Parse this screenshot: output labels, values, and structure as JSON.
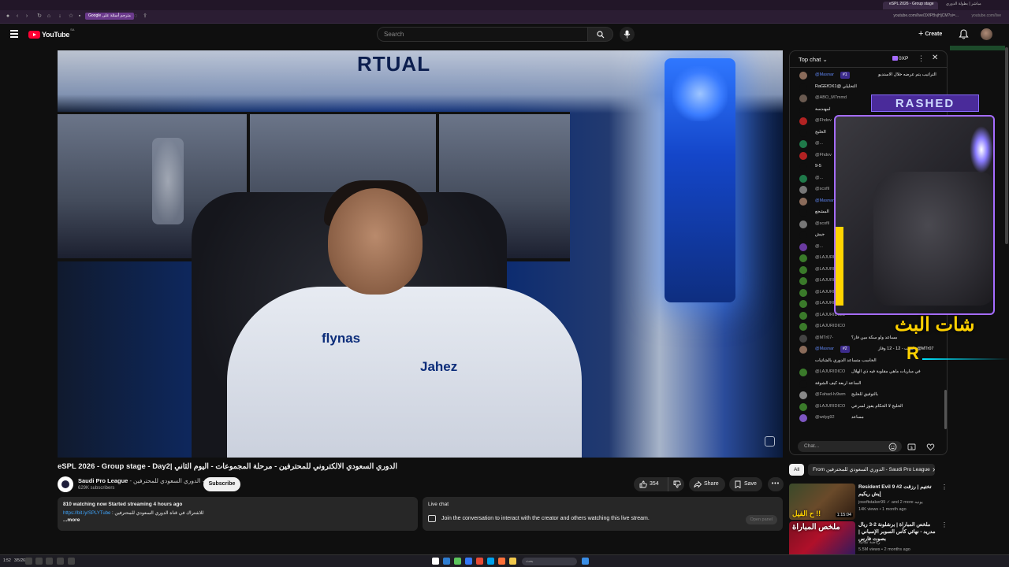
{
  "browser": {
    "tabs": [
      "eSPL 2026 - Group stage",
      "مباشر | بطولة الدوري"
    ],
    "bookmark_pill": "Google مترجم أسئلة على",
    "url": "youtube.com/live/3XfPBvjHjCM?si=...",
    "url_right": "youtube.com/live"
  },
  "header": {
    "logo_text": "YouTube",
    "region": "SA",
    "search_placeholder": "Search",
    "create_label": "Create"
  },
  "video": {
    "shirt_sponsor": "flynas",
    "shirt_brand": "Jahez",
    "banner_text": "RTUAL",
    "title": "eSPL 2026 - Group stage - Day2| الدوري السعودي الالكتروني للمحترفين - مرحلة المجموعات - اليوم الثاني",
    "channel_name": "Saudi Pro League",
    "channel_name_ar": "الدوري السعودي للمحترفين",
    "subscribers": "629K subscribers",
    "subscribe_label": "Subscribe",
    "likes": "354",
    "share_label": "Share",
    "save_label": "Save",
    "more_label": "•••"
  },
  "description": {
    "line1": "810 watching now  Started streaming 4 hours ago",
    "link": "https://bit.ly/SPLYTube",
    "line2_text": ": للاشتراك في قناة الدوري السعودي للمحترفين",
    "more": "...more"
  },
  "live_chat_card": {
    "title": "Live chat",
    "text": "Join the conversation to interact with the creator and others watching this live stream.",
    "open_panel": "Open panel"
  },
  "chat": {
    "header": "Top chat",
    "xp": "0XP",
    "input_placeholder": "Chat...",
    "messages": [
      {
        "name": "@Masnar",
        "badge": "#1",
        "text": "التراتيب يتم عرضه خلال الاستديو",
        "mod": true,
        "color": "#8a6b5a"
      },
      {
        "name": "",
        "badge": "",
        "text": "RaGEfOX1@ التحليلي",
        "mod": false,
        "color": "#0f0f0f"
      },
      {
        "name": "@ABO_M7mmd",
        "badge": "",
        "text": "",
        "mod": false,
        "color": "#6a5a50"
      },
      {
        "name": "",
        "badge": "",
        "text": "لمهندسة",
        "mod": false,
        "color": "#0f0f0f"
      },
      {
        "name": "@Fhdov",
        "badge": "",
        "text": "",
        "mod": false,
        "color": "#b22222"
      },
      {
        "name": "",
        "badge": "",
        "text": "الخليج",
        "mod": false,
        "color": "#0f0f0f"
      },
      {
        "name": "@...",
        "badge": "",
        "text": "5-9",
        "mod": false,
        "color": "#1f7a4a"
      },
      {
        "name": "@Fhdov",
        "badge": "",
        "text": "",
        "mod": false,
        "color": "#b22222"
      },
      {
        "name": "",
        "badge": "",
        "text": "9-5",
        "mod": false,
        "color": "#0f0f0f"
      },
      {
        "name": "@...",
        "badge": "",
        "text": "5-9",
        "mod": false,
        "color": "#1f7a4a"
      },
      {
        "name": "@scofil",
        "badge": "",
        "text": "",
        "mod": false,
        "color": "#777"
      },
      {
        "name": "@Masnar",
        "badge": "",
        "text": "",
        "mod": true,
        "color": "#8a6b5a"
      },
      {
        "name": "",
        "badge": "",
        "text": "المشجع",
        "mod": false,
        "color": "#0f0f0f"
      },
      {
        "name": "@scofil",
        "badge": "",
        "text": "",
        "mod": false,
        "color": "#777"
      },
      {
        "name": "",
        "badge": "",
        "text": "جيش",
        "mod": false,
        "color": "#0f0f0f"
      },
      {
        "name": "@...",
        "badge": "",
        "text": "9-5",
        "mod": false,
        "color": "#6a3aa0"
      },
      {
        "name": "@LAJURIDICO",
        "badge": "",
        "text": "",
        "mod": false,
        "color": "#3a7a2a"
      },
      {
        "name": "@LAJURIDICO",
        "badge": "",
        "text": "",
        "mod": false,
        "color": "#3a7a2a"
      },
      {
        "name": "@LAJURIDICO",
        "badge": "",
        "text": "",
        "mod": false,
        "color": "#3a7a2a"
      },
      {
        "name": "@LAJURIDICO",
        "badge": "",
        "text": "",
        "mod": false,
        "color": "#3a7a2a"
      },
      {
        "name": "@LAJURIDICO",
        "badge": "",
        "text": "",
        "mod": false,
        "color": "#3a7a2a"
      },
      {
        "name": "@LAJURIDICO",
        "badge": "",
        "text": "",
        "mod": false,
        "color": "#3a7a2a"
      },
      {
        "name": "@LAJURIDICO",
        "badge": "",
        "text": "",
        "mod": false,
        "color": "#3a7a2a"
      },
      {
        "name": "@MTr07-",
        "badge": "",
        "text": "مساعد ولو سكة مين فاز؟",
        "mod": false,
        "color": "#444"
      },
      {
        "name": "@Masnar",
        "badge": "#2",
        "text": "انتهت - 12 - 12 وفاز -@MTr07",
        "mod": true,
        "color": "#8a6b5a"
      },
      {
        "name": "",
        "badge": "",
        "text": "الخاسب متساعد الدوري بالشاتيات",
        "mod": false,
        "color": "#0f0f0f"
      },
      {
        "name": "@LAJURIDICO",
        "badge": "",
        "text": "في مباريات ماهي مقلوبة فيه ذي الهلال",
        "mod": false,
        "color": "#3a7a2a"
      },
      {
        "name": "",
        "badge": "",
        "text": "الساعة اربعة كيف الشوفة",
        "mod": false,
        "color": "#0f0f0f"
      },
      {
        "name": "@Fahad-lv9wm",
        "badge": "",
        "text": "بالتوفيق للخليج",
        "mod": false,
        "color": "#888"
      },
      {
        "name": "@LAJURIDICO",
        "badge": "",
        "text": "الخليج لا الحكام يفوز لسرعي",
        "mod": false,
        "color": "#3a7a2a"
      },
      {
        "name": "@wdyg92",
        "badge": "",
        "text": "مساعد",
        "mod": false,
        "color": "#7e57c2"
      }
    ]
  },
  "overlay": {
    "name": "RASHED",
    "chat_label": "شات البث",
    "logo_letter": "R"
  },
  "filters": {
    "all": "All",
    "from": "From الدوري السعودي للمحترفين - Saudi Pro League"
  },
  "recommendations": [
    {
      "title": "Resident Evil 9 #2 تختيم | رزقت إيش ريكيم",
      "channel": "josoftstaker99 ✓ and 2 more يونيه",
      "meta": "14K views • 1 month ago",
      "duration": "1:15:04",
      "thumb_text": "ح الفيل !!"
    },
    {
      "title": "ملخص المباراة | برشلونة 2-3 ريال مدريد - نهائي كأس السوبر الإسباني | بصوت فارس",
      "channel": "رياضة ثمانية",
      "meta": "5.5M views • 2 months ago",
      "duration": "",
      "thumb_text": "ملخص المباراة"
    }
  ],
  "taskbar": {
    "time": "1:52",
    "date": "3/5/26",
    "search_placeholder": "بحث"
  }
}
